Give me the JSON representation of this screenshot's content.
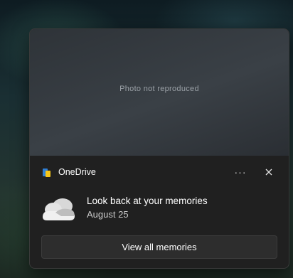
{
  "notification": {
    "app_name": "OneDrive",
    "more_label": "···",
    "title": "Look back at your memories",
    "date": "August 25",
    "action_label": "View all memories",
    "hero_placeholder": "Photo not reproduced"
  },
  "icons": {
    "app": "onedrive-logo-icon",
    "close": "close-icon",
    "cloud": "onedrive-cloud-icon"
  },
  "colors": {
    "toast_bg": "#202020",
    "button_bg": "#2d2d2d",
    "text_primary": "#ffffff",
    "text_secondary": "#c9c9c9"
  }
}
